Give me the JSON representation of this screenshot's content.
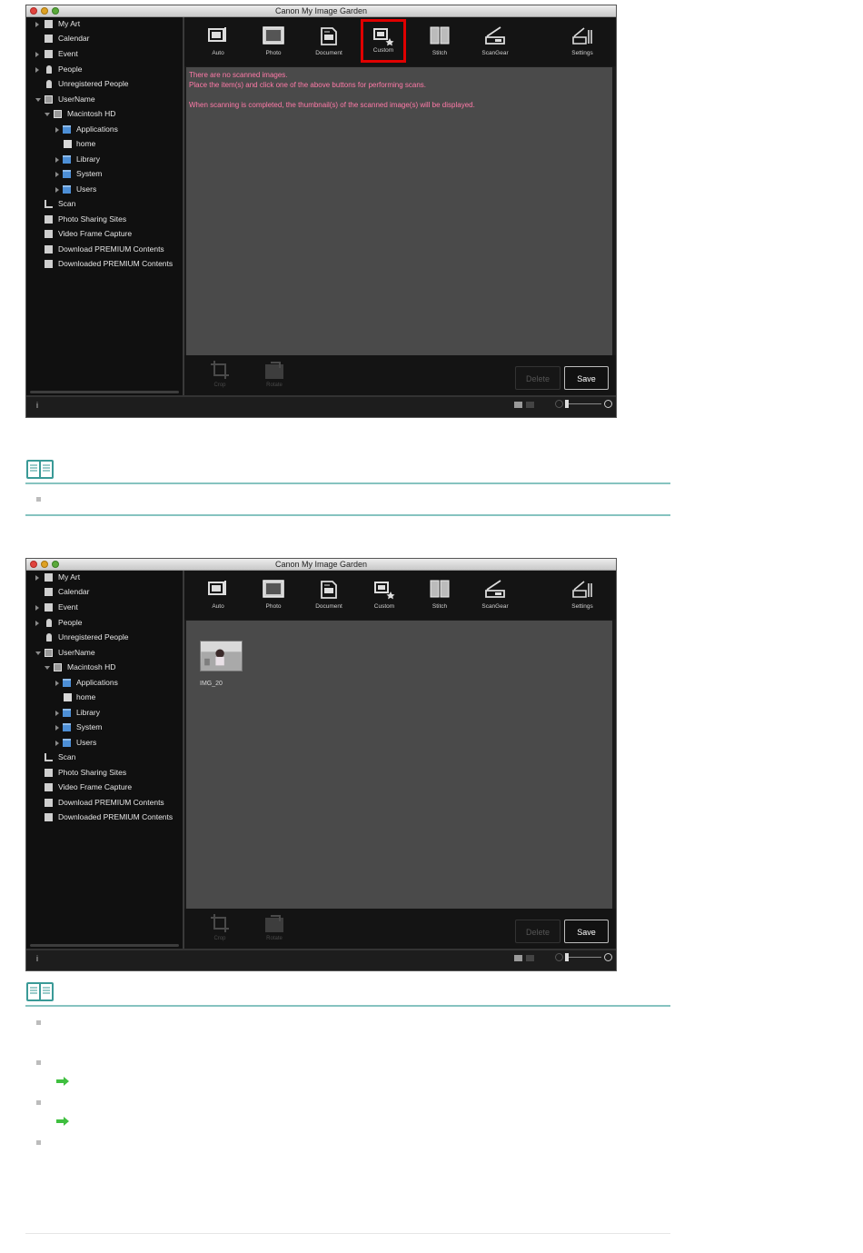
{
  "window1": {
    "title": "Canon My Image Garden",
    "sidebar": [
      {
        "label": "My Art"
      },
      {
        "label": "Calendar"
      },
      {
        "label": "Event"
      },
      {
        "label": "People"
      },
      {
        "label": "Unregistered People"
      },
      {
        "label": "UserName"
      },
      {
        "label": "Macintosh HD"
      },
      {
        "label": "Applications"
      },
      {
        "label": "home"
      },
      {
        "label": "Library"
      },
      {
        "label": "System"
      },
      {
        "label": "Users"
      },
      {
        "label": "Scan"
      },
      {
        "label": "Photo Sharing Sites"
      },
      {
        "label": "Video Frame Capture"
      },
      {
        "label": "Download PREMIUM Contents"
      },
      {
        "label": "Downloaded PREMIUM Contents"
      }
    ],
    "toolbar": [
      "Auto",
      "Photo",
      "Document",
      "Custom",
      "Stitch",
      "ScanGear",
      "Settings"
    ],
    "selected_tool": "Custom",
    "messages": [
      "There are no scanned images.",
      "Place the item(s) and click one of the above buttons for performing scans.",
      "When scanning is completed, the thumbnail(s) of the scanned image(s) will be displayed."
    ],
    "bottom_tools": [
      "Crop",
      "Rotate"
    ],
    "delete_label": "Delete",
    "save_label": "Save",
    "status_info": "i"
  },
  "window2": {
    "title": "Canon My Image Garden",
    "toolbar": [
      "Auto",
      "Photo",
      "Document",
      "Custom",
      "Stitch",
      "ScanGear",
      "Settings"
    ],
    "thumbnail_label": "IMG_20",
    "bottom_tools": [
      "Crop",
      "Rotate"
    ],
    "delete_label": "Delete",
    "save_label": "Save",
    "status_info": "i"
  },
  "colors": {
    "highlight": "#e00000",
    "message": "#ff7aa8",
    "note_line": "#86c3c0",
    "arrow": "#3fbf3f"
  },
  "icons": [
    "note-book-icon",
    "bullet-icon",
    "green-arrow-icon"
  ]
}
